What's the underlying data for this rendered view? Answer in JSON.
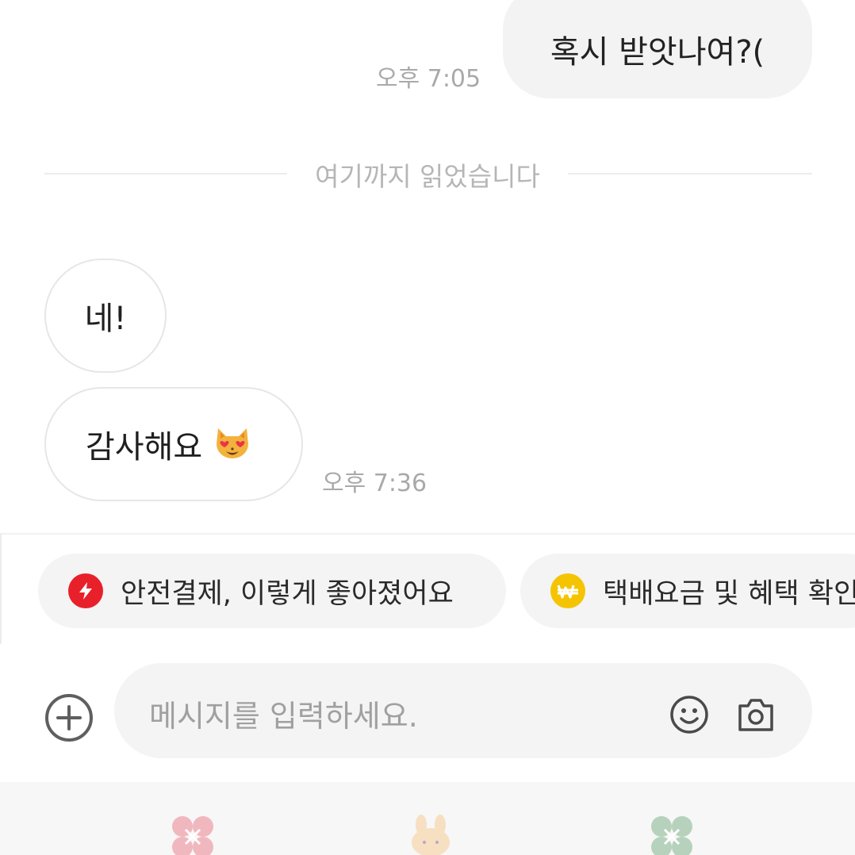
{
  "messages": {
    "outgoing": {
      "text": "혹시 받앗나여?(",
      "time": "오후 7:05"
    },
    "divider": "여기까지 읽었습니다",
    "incoming": [
      {
        "text": "네!"
      },
      {
        "text": "감사해요",
        "emoji": "smiling-cat-with-heart-eyes"
      }
    ],
    "incoming_time": "오후 7:36"
  },
  "chips": [
    {
      "label": "안전결제, 이렇게 좋아졌어요",
      "icon": "lightning-icon",
      "color": "#e8202a"
    },
    {
      "label": "택배요금 및 혜택 확인",
      "icon": "won-coin-icon",
      "color": "#f5c400"
    }
  ],
  "composer": {
    "placeholder": "메시지를 입력하세요."
  },
  "colors": {
    "bubble_out": "#f3f3f3",
    "bubble_in_border": "#e6e6e6",
    "chip_bg": "#f4f4f4"
  }
}
